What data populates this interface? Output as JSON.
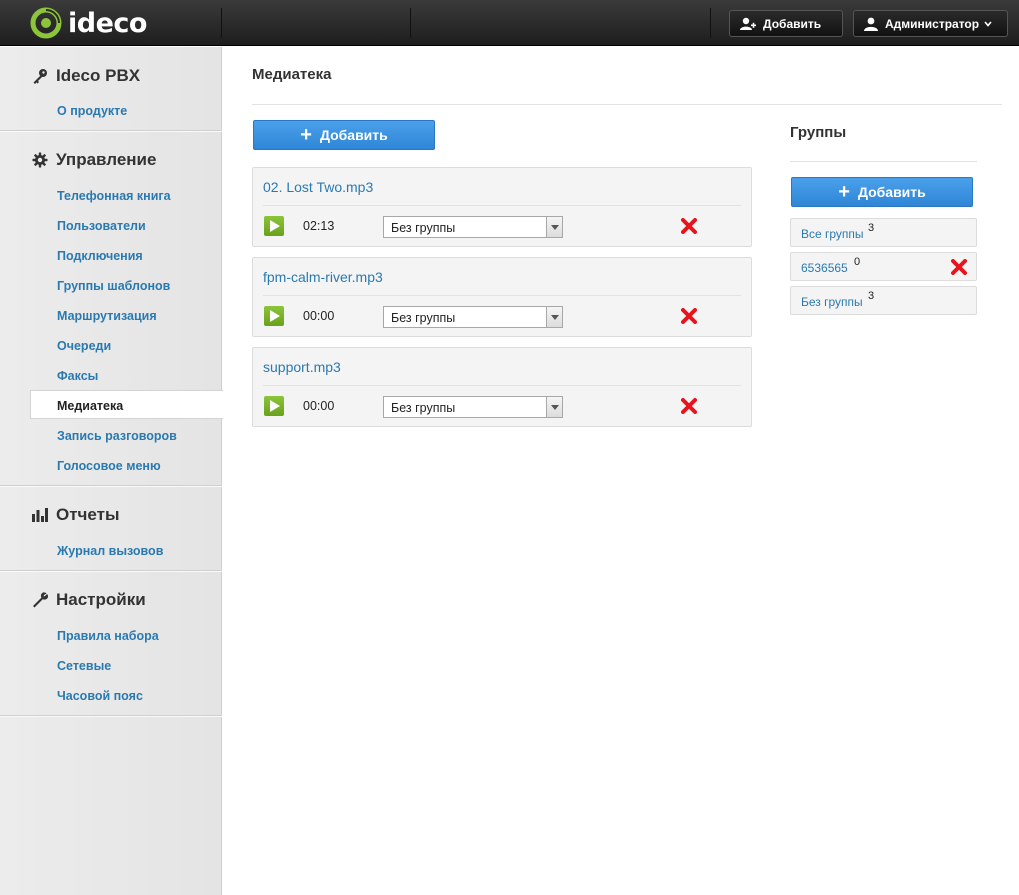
{
  "header": {
    "logo_text": "ideco",
    "add_label": "Добавить",
    "user_label": "Администратор"
  },
  "sidebar": {
    "sections": [
      {
        "title": "Ideco PBX",
        "icon": "key-icon",
        "items": [
          "О продукте"
        ]
      },
      {
        "title": "Управление",
        "icon": "gear-icon",
        "items": [
          "Телефонная книга",
          "Пользователи",
          "Подключения",
          "Группы шаблонов",
          "Маршрутизация",
          "Очереди",
          "Факсы",
          "Медиатека",
          "Запись разговоров",
          "Голосовое меню"
        ]
      },
      {
        "title": "Отчеты",
        "icon": "bar-chart-icon",
        "items": [
          "Журнал вызовов"
        ]
      },
      {
        "title": "Настройки",
        "icon": "wrench-icon",
        "items": [
          "Правила набора",
          "Сетевые",
          "Часовой пояс"
        ]
      }
    ],
    "active_item": "Медиатека"
  },
  "main": {
    "title": "Медиатека",
    "add_label": "Добавить",
    "files": [
      {
        "name": "02. Lost Two.mp3",
        "duration": "02:13",
        "group": "Без группы"
      },
      {
        "name": "fpm-calm-river.mp3",
        "duration": "00:00",
        "group": "Без группы"
      },
      {
        "name": "support.mp3",
        "duration": "00:00",
        "group": "Без группы"
      }
    ]
  },
  "groups": {
    "title": "Группы",
    "add_label": "Добавить",
    "items": [
      {
        "label": "Все группы",
        "count": "3",
        "deletable": false
      },
      {
        "label": "6536565",
        "count": "0",
        "deletable": true
      },
      {
        "label": "Без группы",
        "count": "3",
        "deletable": false
      }
    ]
  },
  "colors": {
    "accent": "#2f86d6",
    "link": "#2a7ab0",
    "play": "#7ab32a",
    "delete": "#e8141c"
  }
}
